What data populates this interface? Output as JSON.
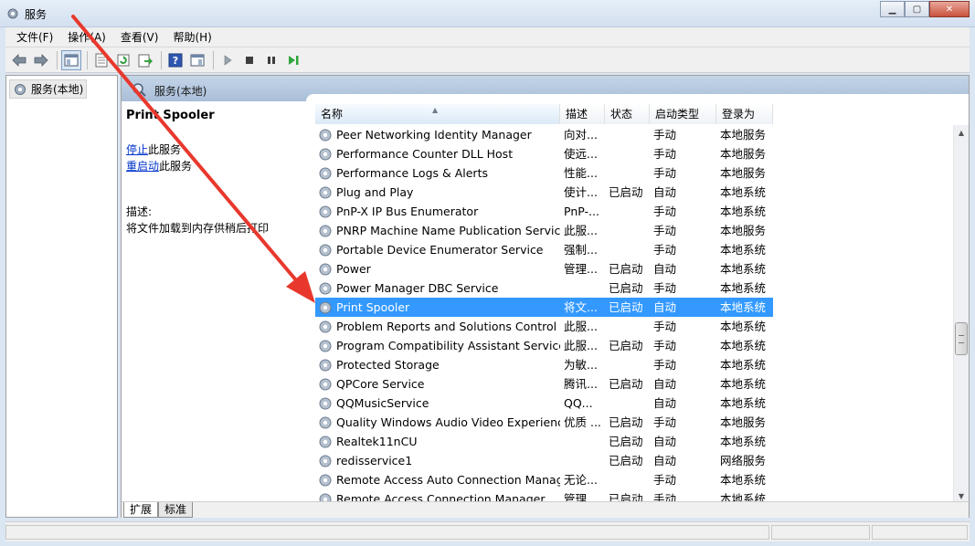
{
  "window": {
    "title": "服务"
  },
  "menu": [
    "文件(F)",
    "操作(A)",
    "查看(V)",
    "帮助(H)"
  ],
  "tree": {
    "root": "服务(本地)"
  },
  "pane_header": "服务(本地)",
  "detail": {
    "title": "Print Spooler",
    "stop_link": "停止",
    "stop_suffix": "此服务",
    "restart_link": "重启动",
    "restart_suffix": "此服务",
    "desc_label": "描述:",
    "desc_text": "将文件加载到内存供稍后打印"
  },
  "columns": [
    "名称",
    "描述",
    "状态",
    "启动类型",
    "登录为"
  ],
  "rows": [
    {
      "name": "Peer Networking Identity Manager",
      "desc": "向对...",
      "status": "",
      "startup": "手动",
      "logon": "本地服务"
    },
    {
      "name": "Performance Counter DLL Host",
      "desc": "使远...",
      "status": "",
      "startup": "手动",
      "logon": "本地服务"
    },
    {
      "name": "Performance Logs & Alerts",
      "desc": "性能...",
      "status": "",
      "startup": "手动",
      "logon": "本地服务"
    },
    {
      "name": "Plug and Play",
      "desc": "使计...",
      "status": "已启动",
      "startup": "自动",
      "logon": "本地系统"
    },
    {
      "name": "PnP-X IP Bus Enumerator",
      "desc": "PnP-...",
      "status": "",
      "startup": "手动",
      "logon": "本地系统"
    },
    {
      "name": "PNRP Machine Name Publication Service",
      "desc": "此服...",
      "status": "",
      "startup": "手动",
      "logon": "本地服务"
    },
    {
      "name": "Portable Device Enumerator Service",
      "desc": "强制...",
      "status": "",
      "startup": "手动",
      "logon": "本地系统"
    },
    {
      "name": "Power",
      "desc": "管理...",
      "status": "已启动",
      "startup": "自动",
      "logon": "本地系统"
    },
    {
      "name": "Power Manager DBC Service",
      "desc": "",
      "status": "已启动",
      "startup": "手动",
      "logon": "本地系统"
    },
    {
      "name": "Print Spooler",
      "desc": "将文...",
      "status": "已启动",
      "startup": "自动",
      "logon": "本地系统",
      "selected": true
    },
    {
      "name": "Problem Reports and Solutions Control ...",
      "desc": "此服...",
      "status": "",
      "startup": "手动",
      "logon": "本地系统"
    },
    {
      "name": "Program Compatibility Assistant Service",
      "desc": "此服...",
      "status": "已启动",
      "startup": "手动",
      "logon": "本地系统"
    },
    {
      "name": "Protected Storage",
      "desc": "为敏...",
      "status": "",
      "startup": "手动",
      "logon": "本地系统"
    },
    {
      "name": "QPCore Service",
      "desc": "腾讯...",
      "status": "已启动",
      "startup": "自动",
      "logon": "本地系统"
    },
    {
      "name": "QQMusicService",
      "desc": "QQ...",
      "status": "",
      "startup": "自动",
      "logon": "本地系统"
    },
    {
      "name": "Quality Windows Audio Video Experience",
      "desc": "优质 ...",
      "status": "已启动",
      "startup": "手动",
      "logon": "本地服务"
    },
    {
      "name": "Realtek11nCU",
      "desc": "",
      "status": "已启动",
      "startup": "自动",
      "logon": "本地系统"
    },
    {
      "name": "redisservice1",
      "desc": "",
      "status": "已启动",
      "startup": "自动",
      "logon": "网络服务"
    },
    {
      "name": "Remote Access Auto Connection Manager",
      "desc": "无论...",
      "status": "",
      "startup": "手动",
      "logon": "本地系统"
    },
    {
      "name": "Remote Access Connection Manager",
      "desc": "管理...",
      "status": "已启动",
      "startup": "手动",
      "logon": "本地系统"
    }
  ],
  "tabs": [
    "扩展",
    "标准"
  ],
  "colors": {
    "selection": "#3399ff",
    "link": "#0033cc",
    "annotation_arrow": "#e8382d"
  }
}
